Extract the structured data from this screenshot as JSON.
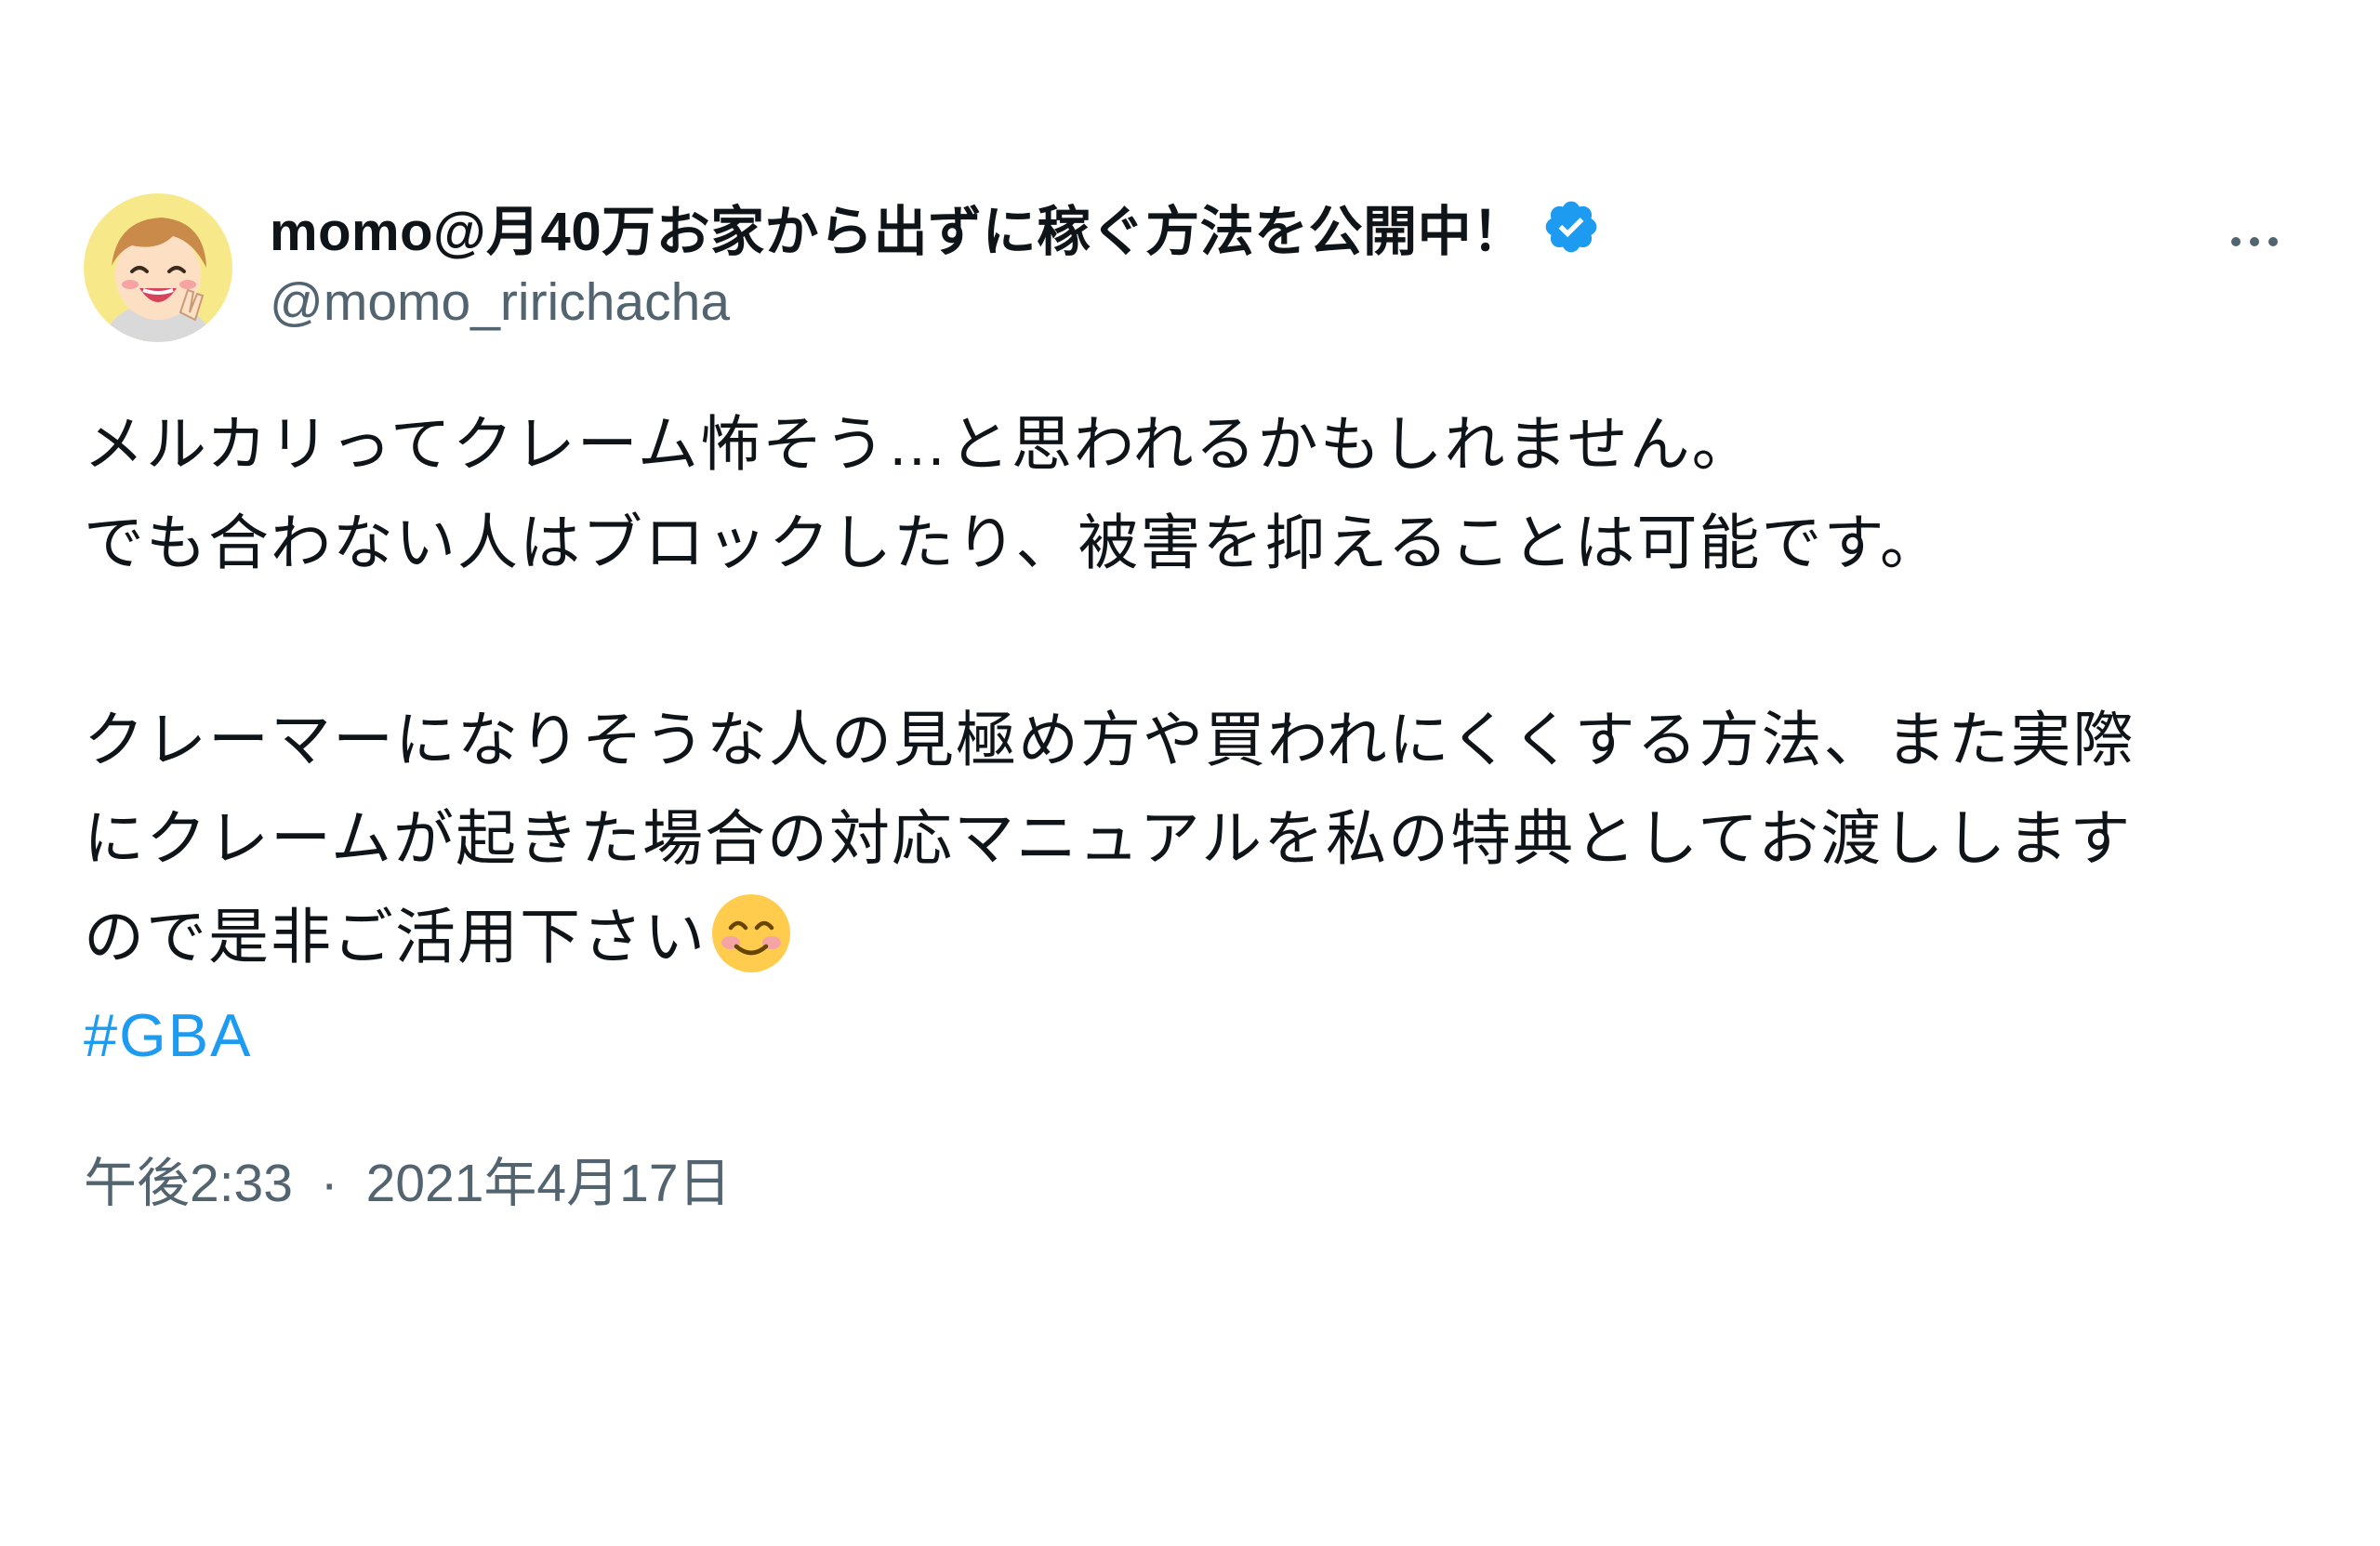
{
  "tweet": {
    "author": {
      "display_name": "momo@月40万お家から出ずに稼ぐ方法を公開中！",
      "handle": "@momo_ririchacha",
      "verified": true,
      "avatar_icon": "avatar-cartoon-face"
    },
    "more_icon": "more-horizontal-icon",
    "body_lines": [
      "メルカリってクレーム怖そう…と思われるかもしれません。",
      "でも合わない人はブロックしたり、被害を抑えることは可能です。",
      "",
      "クレーマーになりそうな人の見極め方や買われにくくする方法、また実際",
      "にクレームが起きた場合の対応マニュアルを私の特典としてお渡しします",
      "ので是非ご活用下さい"
    ],
    "emoji": "smiling-face-with-smiling-eyes",
    "hashtag": "#GBA",
    "time": "午後2:33",
    "separator": "·",
    "date": "2021年4月17日"
  },
  "colors": {
    "text": "#0f1419",
    "secondary": "#536471",
    "link": "#1d9bf0",
    "verified": "#1d9bf0"
  }
}
